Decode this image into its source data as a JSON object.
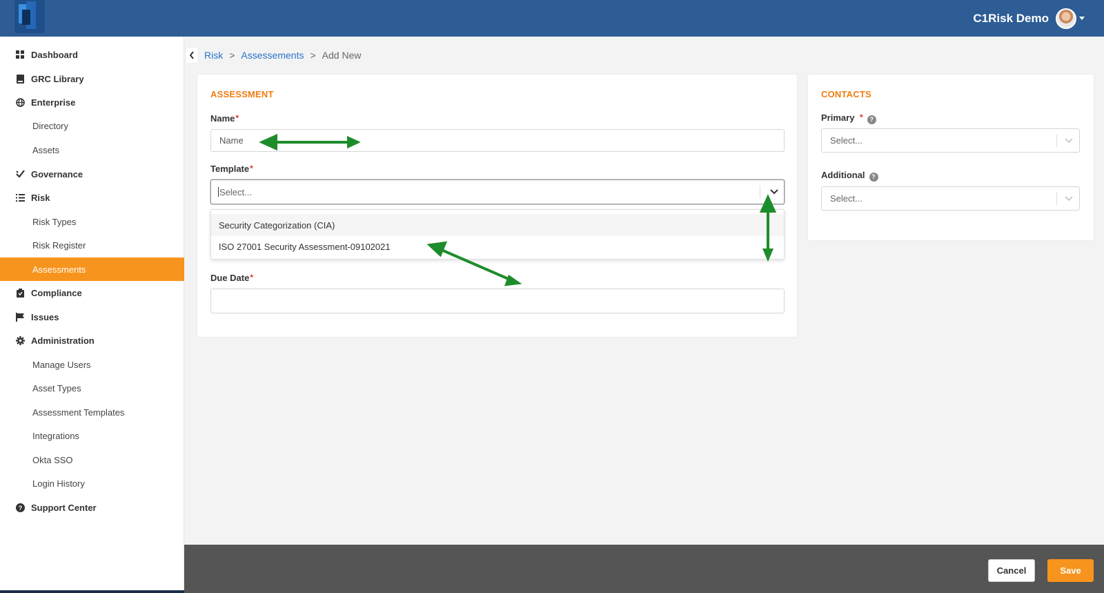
{
  "header": {
    "user_name": "C1Risk Demo",
    "brand_color": "#2d5d94"
  },
  "sidebar": {
    "items": [
      {
        "label": "Dashboard",
        "level": "top",
        "icon": "grid-icon"
      },
      {
        "label": "GRC Library",
        "level": "top",
        "icon": "book-icon"
      },
      {
        "label": "Enterprise",
        "level": "top",
        "icon": "globe-icon"
      },
      {
        "label": "Directory",
        "level": "sub"
      },
      {
        "label": "Assets",
        "level": "sub"
      },
      {
        "label": "Governance",
        "level": "top",
        "icon": "check-icon"
      },
      {
        "label": "Risk",
        "level": "top",
        "icon": "list-icon"
      },
      {
        "label": "Risk Types",
        "level": "sub"
      },
      {
        "label": "Risk Register",
        "level": "sub"
      },
      {
        "label": "Assessments",
        "level": "sub",
        "active": true
      },
      {
        "label": "Compliance",
        "level": "top",
        "icon": "clipboard-icon"
      },
      {
        "label": "Issues",
        "level": "top",
        "icon": "flag-icon"
      },
      {
        "label": "Administration",
        "level": "top",
        "icon": "gear-icon"
      },
      {
        "label": "Manage Users",
        "level": "sub"
      },
      {
        "label": "Asset Types",
        "level": "sub"
      },
      {
        "label": "Assessment Templates",
        "level": "sub"
      },
      {
        "label": "Integrations",
        "level": "sub"
      },
      {
        "label": "Okta SSO",
        "level": "sub"
      },
      {
        "label": "Login History",
        "level": "sub"
      },
      {
        "label": "Support Center",
        "level": "top",
        "icon": "help-circle-icon"
      }
    ],
    "active_color": "#f7941d"
  },
  "breadcrumb": {
    "items": [
      "Risk",
      "Assessements",
      "Add New"
    ],
    "separator": ">"
  },
  "assessment": {
    "section_title": "ASSESSMENT",
    "name_label": "Name",
    "name_placeholder": "Name",
    "template_label": "Template",
    "template_placeholder": "Select...",
    "template_options": [
      "Security Categorization (CIA)",
      "ISO 27001 Security Assessment-09102021"
    ],
    "due_date_label": "Due Date",
    "required_mark": "*"
  },
  "contacts": {
    "section_title": "CONTACTS",
    "primary_label": "Primary",
    "primary_placeholder": "Select...",
    "additional_label": "Additional",
    "additional_placeholder": "Select..."
  },
  "footer": {
    "cancel_label": "Cancel",
    "save_label": "Save"
  },
  "annotation_color": "#1e8c2a"
}
